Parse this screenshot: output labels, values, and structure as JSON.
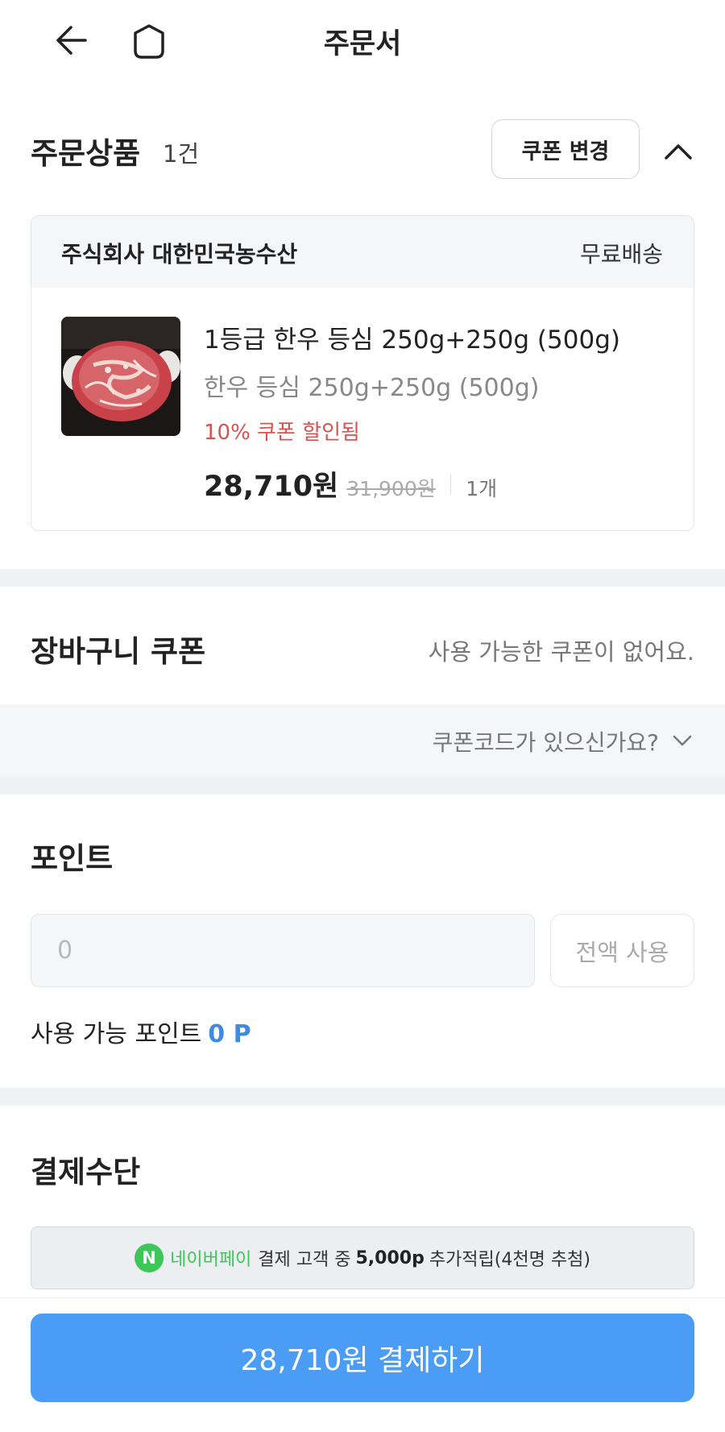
{
  "header": {
    "title": "주문서",
    "back_icon": "arrow-left-icon",
    "home_icon": "hexagon-home-icon"
  },
  "order_items": {
    "title": "주문상품",
    "count": "1건",
    "coupon_change_label": "쿠폰 변경",
    "collapse_icon": "chevron-up-icon",
    "seller": {
      "name": "주식회사 대한민국농수산",
      "shipping": "무료배송"
    },
    "product": {
      "name": "1등급 한우 등심 250g+250g (500g)",
      "option": "한우 등심 250g+250g (500g)",
      "discount_note": "10% 쿠폰 할인됨",
      "price": "28,710원",
      "original_price": "31,900원",
      "quantity": "1개"
    }
  },
  "cart_coupon": {
    "title": "장바구니 쿠폰",
    "message": "사용 가능한 쿠폰이 없어요.",
    "code_prompt": "쿠폰코드가 있으신가요?",
    "code_icon": "chevron-down-icon"
  },
  "points": {
    "title": "포인트",
    "input_placeholder": "0",
    "use_all_label": "전액 사용",
    "available_label": "사용 가능 포인트",
    "available_value": "0 P"
  },
  "payment": {
    "title": "결제수단",
    "naver_badge": "N",
    "naver_name": "네이버페이",
    "promo_pre": "결제 고객 중",
    "promo_bonus": "5,000p",
    "promo_post": "추가적립(4천명 추첨)"
  },
  "pay_button": {
    "label": "28,710원 결제하기"
  },
  "colors": {
    "accent": "#4a9cf5",
    "discount_red": "#d9534f",
    "point_blue": "#3d8ce0",
    "naver_green": "#3ec759"
  }
}
